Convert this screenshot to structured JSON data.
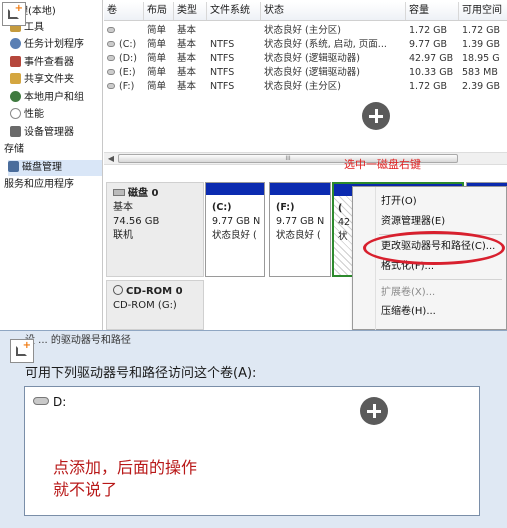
{
  "tree": {
    "items": [
      {
        "label": "理(本地)",
        "icon_color": "#6a7fa5"
      },
      {
        "label": "工具",
        "icon_color": "#c59b3e"
      },
      {
        "label": "任务计划程序",
        "icon_color": "#5a7fb4"
      },
      {
        "label": "事件查看器",
        "icon_color": "#b5473c"
      },
      {
        "label": "共享文件夹",
        "icon_color": "#d4a640"
      },
      {
        "label": "本地用户和组",
        "icon_color": "#3f7a3f"
      },
      {
        "label": "性能",
        "icon_color": "#8a8a8a"
      },
      {
        "label": "设备管理器",
        "icon_color": "#6a6a6a"
      },
      {
        "label": "存储",
        "icon_color": ""
      },
      {
        "label": "磁盘管理",
        "icon_color": "#4a6d9c"
      },
      {
        "label": "服务和应用程序",
        "icon_color": ""
      }
    ]
  },
  "volume_table": {
    "headers": [
      "卷",
      "布局",
      "类型",
      "文件系统",
      "状态",
      "容量",
      "可用空间"
    ],
    "rows": [
      {
        "vol": "",
        "layout": "简单",
        "type": "基本",
        "fs": "",
        "status": "状态良好 (主分区)",
        "capacity": "1.72 GB",
        "free": "1.72 GB"
      },
      {
        "vol": "(C:)",
        "layout": "简单",
        "type": "基本",
        "fs": "NTFS",
        "status": "状态良好 (系统, 启动, 页面...",
        "capacity": "9.77 GB",
        "free": "1.39 GB"
      },
      {
        "vol": "(D:)",
        "layout": "简单",
        "type": "基本",
        "fs": "NTFS",
        "status": "状态良好 (逻辑驱动器)",
        "capacity": "42.97 GB",
        "free": "18.95 G"
      },
      {
        "vol": "(E:)",
        "layout": "简单",
        "type": "基本",
        "fs": "NTFS",
        "status": "状态良好 (逻辑驱动器)",
        "capacity": "10.33 GB",
        "free": "583 MB"
      },
      {
        "vol": "(F:)",
        "layout": "简单",
        "type": "基本",
        "fs": "NTFS",
        "status": "状态良好 (主分区)",
        "capacity": "1.72 GB",
        "free": "2.39 GB"
      }
    ]
  },
  "scrollbar": {
    "grip": "III",
    "left_arrow": "◀",
    "right_arrow": "▶"
  },
  "hint_label": "选中一磁盘右键",
  "disk0": {
    "title": "磁盘 0",
    "type": "基本",
    "size": "74.56 GB",
    "status": "联机"
  },
  "cdrom": {
    "title": "CD-ROM 0",
    "sub": "CD-ROM (G:)"
  },
  "partitions": [
    {
      "name": "(C:)",
      "size": "9.77 GB N",
      "status": "状态良好 ("
    },
    {
      "name": "(F:)",
      "size": "9.77 GB N",
      "status": "状态良好 ("
    },
    {
      "name": "(",
      "size": "42",
      "status": "状"
    }
  ],
  "context_menu": {
    "items": [
      {
        "label": "打开(O)",
        "enabled": true
      },
      {
        "label": "资源管理器(E)",
        "enabled": true
      },
      {
        "label": "更改驱动器号和路径(C)...",
        "enabled": true
      },
      {
        "label": "格式化(F)...",
        "enabled": true
      },
      {
        "label": "扩展卷(X)...",
        "enabled": false
      },
      {
        "label": "压缩卷(H)...",
        "enabled": true
      }
    ]
  },
  "dialog": {
    "title": "设 ... 的驱动器号和路径",
    "prompt": "可用下列驱动器号和路径访问这个卷(A):",
    "drive_entry": "D:",
    "annotation": "点添加，后面的操作\n就不说了"
  },
  "colors": {
    "accent_red": "#d8202e",
    "partition_bar": "#0b2bb0",
    "selection_green": "#2d8a2d"
  }
}
